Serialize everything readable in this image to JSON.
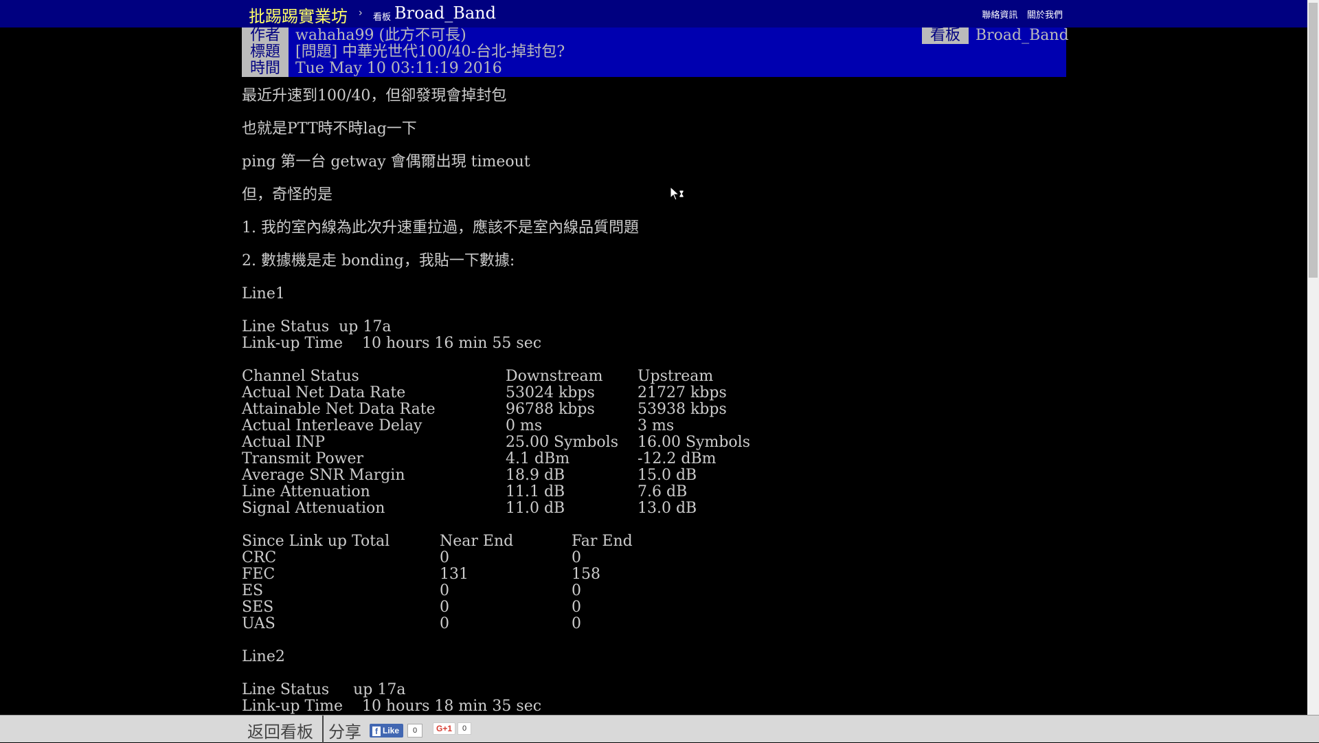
{
  "topbar": {
    "site_name": "批踢踢實業坊",
    "separator": "›",
    "board_tag": "看板",
    "board_name": "Broad_Band",
    "links": [
      "聯絡資訊",
      "關於我們"
    ]
  },
  "header": {
    "author_tag": "作者",
    "author": "wahaha99 (此方不可長)",
    "title_tag": "標題",
    "title": "[問題] 中華光世代100/40-台北-掉封包?",
    "time_tag": "時間",
    "time": "Tue May 10 03:11:19 2016",
    "board_tag": "看板",
    "board": "Broad_Band"
  },
  "body": {
    "intro": [
      "最近升速到100/40，但卻發現會掉封包",
      "也就是PTT時不時lag一下",
      "ping 第一台 getway 會偶爾出現 timeout",
      "但，奇怪的是",
      "1. 我的室內線為此次升速重拉過，應該不是室內線品質問題",
      "2. 數據機是走 bonding，我貼一下數據:"
    ],
    "line1": {
      "name": "Line1",
      "status": "Line Status  up 17a",
      "linkup": "Link-up Time    10 hours 16 min 55 sec",
      "channel_header": [
        "Channel Status",
        "Downstream",
        "Upstream"
      ],
      "channel_rows": [
        [
          "Actual Net Data Rate",
          "53024 kbps",
          "21727 kbps"
        ],
        [
          "Attainable Net Data Rate",
          "96788 kbps",
          "53938 kbps"
        ],
        [
          "Actual Interleave Delay",
          "0 ms",
          "3 ms"
        ],
        [
          "Actual INP",
          "25.00 Symbols",
          "16.00 Symbols"
        ],
        [
          "Transmit Power",
          "4.1 dBm",
          "-12.2 dBm"
        ],
        [
          "Average SNR Margin",
          "18.9 dB",
          "15.0 dB"
        ],
        [
          "Line Attenuation",
          "11.1 dB",
          "7.6 dB"
        ],
        [
          "Signal Attenuation",
          "11.0 dB",
          "13.0 dB"
        ]
      ],
      "since_header": [
        "Since Link up Total",
        "Near End",
        "Far End"
      ],
      "since_rows": [
        [
          "CRC",
          "0",
          "0"
        ],
        [
          "FEC",
          "131",
          "158"
        ],
        [
          "ES",
          "0",
          "0"
        ],
        [
          "SES",
          "0",
          "0"
        ],
        [
          "UAS",
          "0",
          "0"
        ]
      ]
    },
    "line2": {
      "name": "Line2",
      "status": "Line Status     up 17a",
      "linkup": "Link-up Time    10 hours 18 min 35 sec"
    }
  },
  "bottombar": {
    "back": "返回看板",
    "share": "分享",
    "fb_like": "Like",
    "fb_count": "0",
    "gplus": "G+1",
    "gplus_count": "0"
  }
}
